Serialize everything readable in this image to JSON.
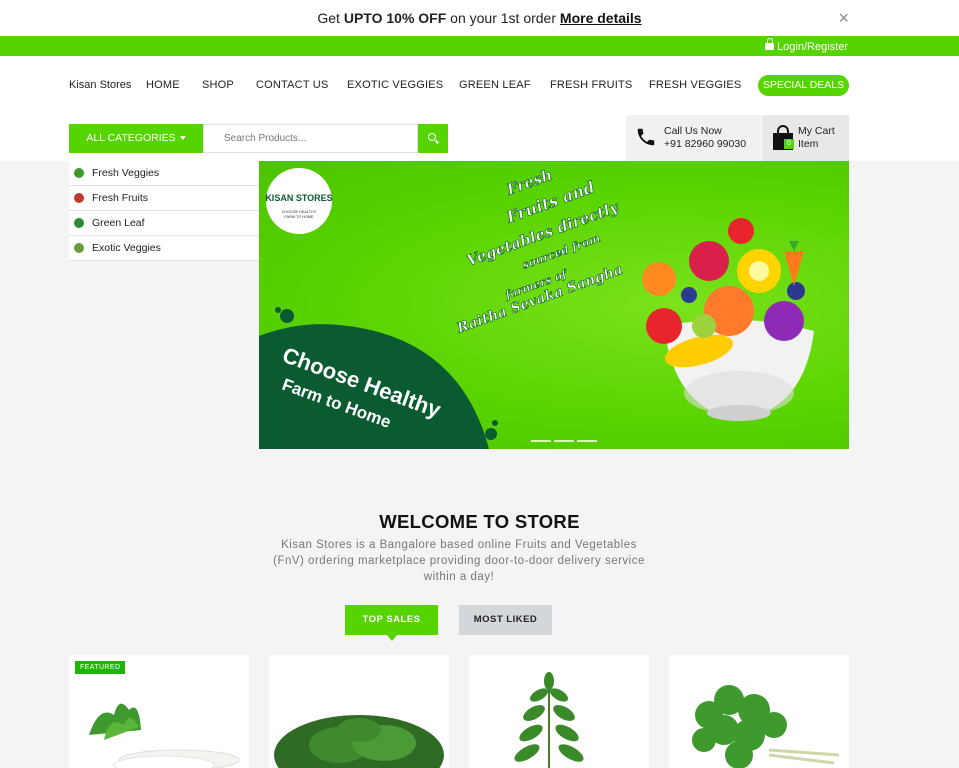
{
  "promo": {
    "text_before": "Get ",
    "highlight": "UPTO 10% OFF",
    "text_after": " on your 1st order ",
    "link": "More details",
    "close": "×"
  },
  "topbar": {
    "login": "Login/Register"
  },
  "header": {
    "brand": "Kisan Stores",
    "nav": [
      "HOME",
      "SHOP",
      "CONTACT US",
      "EXOTIC VEGGIES",
      "GREEN LEAF",
      "FRESH FRUITS",
      "FRESH VEGGIES"
    ],
    "special_deals": "SPECIAL DEALS"
  },
  "search": {
    "category_button": "ALL CATEGORIES",
    "placeholder": "Search Products..."
  },
  "contact": {
    "label": "Call Us Now",
    "phone": "+91 82960 99030"
  },
  "cart": {
    "label": "My Cart",
    "sub": "Item",
    "count": "0"
  },
  "categories": [
    {
      "label": "Fresh Veggies",
      "icon": "veggie-icon",
      "color": "#3a9a2a"
    },
    {
      "label": "Fresh Fruits",
      "icon": "fruit-icon",
      "color": "#c0392b"
    },
    {
      "label": "Green Leaf",
      "icon": "leaf-icon",
      "color": "#2e8b2e"
    },
    {
      "label": "Exotic Veggies",
      "icon": "exotic-icon",
      "color": "#6a9a3a"
    }
  ],
  "banner": {
    "logo_line1": "KISAN STORES",
    "logo_line2": "CHOOSE HEALTHY",
    "logo_line3": "FARM TO HOME",
    "headline1": "Choose Healthy",
    "headline2": "Farm to Home",
    "script1": "Fresh",
    "script2": "Fruits and",
    "script3": "Vegetables directly",
    "script4": "sourced from",
    "script5": "farmers of",
    "script6": "Raitha Sevaka Sangha"
  },
  "welcome": {
    "title": "WELCOME TO STORE",
    "description": "Kisan Stores is a Bangalore based online Fruits and Vegetables (FnV) ordering marketplace providing door-to-door delivery service within a day!"
  },
  "tabs": {
    "top_sales": "TOP SALES",
    "most_liked": "MOST LIKED"
  },
  "products": {
    "featured_badge": "FEATURED"
  },
  "colors": {
    "accent": "#56d400",
    "dark_green": "#0a5a32"
  }
}
